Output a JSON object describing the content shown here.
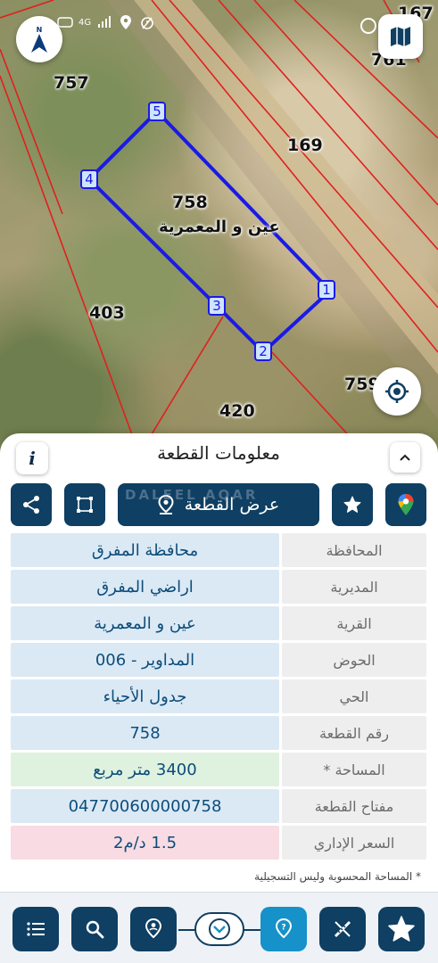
{
  "status_bar": {
    "network": "4G",
    "icons": [
      "whatsapp-icon",
      "signal-icon",
      "location-icon",
      "alarm-icon"
    ]
  },
  "map": {
    "parcel_number": "758",
    "parcel_village": "عين و المعمرية",
    "neighbor_labels": {
      "n757": "757",
      "n403": "403",
      "n420": "420",
      "n169": "169",
      "n167": "167",
      "n761": "761",
      "n759": "759"
    },
    "vertices": [
      "1",
      "2",
      "3",
      "4",
      "5"
    ]
  },
  "panel": {
    "title": "معلومات القطعة",
    "info_label": "i",
    "show_parcel_label": "عرض القطعة",
    "watermark": "DALEEL AQAR",
    "rows": [
      {
        "label": "المحافظة",
        "value": "محافظة المفرق"
      },
      {
        "label": "المديرية",
        "value": "اراضي المفرق"
      },
      {
        "label": "القرية",
        "value": "عين و المعمرية"
      },
      {
        "label": "الحوض",
        "value": "المداوير - 006"
      },
      {
        "label": "الحي",
        "value": "جدول الأحياء"
      },
      {
        "label": "رقم القطعة",
        "value": "758"
      },
      {
        "label": "المساحة *",
        "value": "3400  متر مربع"
      },
      {
        "label": "مفتاح القطعة",
        "value": "047700600000758"
      },
      {
        "label": "السعر الإداري",
        "value": "1.5 د/م2"
      }
    ],
    "footnote": "* المساحة المحسوبة وليس التسجيلية"
  },
  "colors": {
    "primary": "#0f3f62",
    "accent": "#1791c9",
    "parcel_outline": "#1a1ae6",
    "boundary_lines": "#e02020",
    "value_text": "#0d4d7a",
    "area_bg": "#dff2df",
    "price_bg": "#f8dbe3",
    "value_bg": "#dbe9f5"
  }
}
